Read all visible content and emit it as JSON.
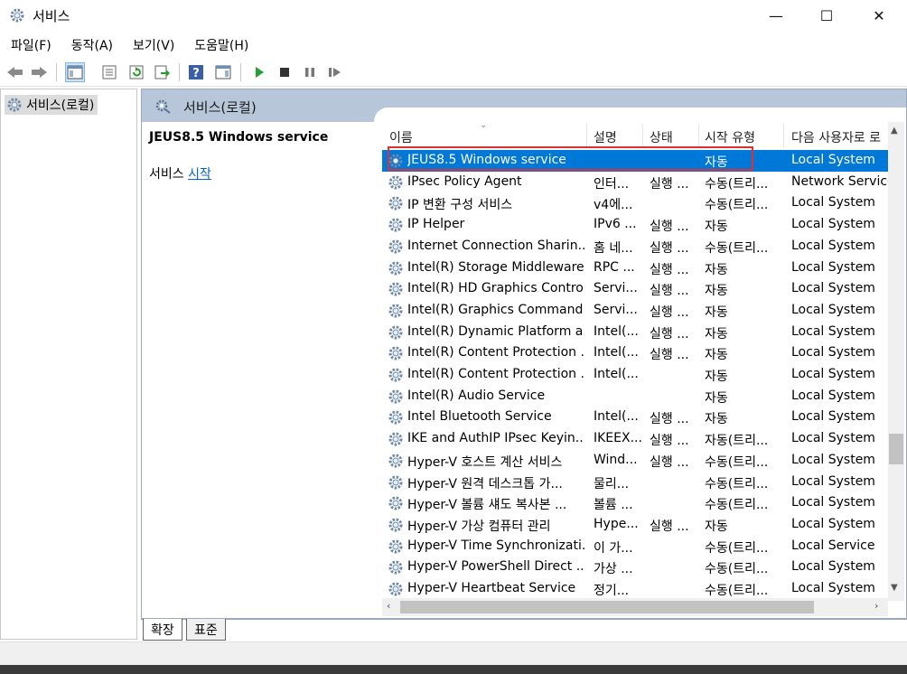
{
  "window": {
    "title": "서비스",
    "minimize_glyph": "—",
    "maximize_glyph": "☐",
    "close_glyph": "✕"
  },
  "menu": [
    "파일(F)",
    "동작(A)",
    "보기(V)",
    "도움말(H)"
  ],
  "toolbar": {
    "buttons": [
      "back-icon",
      "forward-icon",
      "show-hide-console-tree-icon",
      "properties-icon",
      "refresh-icon",
      "export-list-icon",
      "help-icon",
      "show-hide-action-pane-icon",
      "start-service-icon",
      "stop-service-icon",
      "pause-service-icon",
      "restart-service-icon"
    ]
  },
  "tree": {
    "node_label": "서비스(로컬)"
  },
  "panel": {
    "header_title": "서비스(로컬)",
    "selected_service_title": "JEUS8.5 Windows service",
    "action_prefix": "서비스 ",
    "action_link": "시작"
  },
  "columns": {
    "name": "이름",
    "description": "설명",
    "status": "상태",
    "startup": "시작 유형",
    "logon": "다음 사용자로 로"
  },
  "services": [
    {
      "name": "JEUS8.5 Windows service",
      "desc": "",
      "status": "",
      "startup": "자동",
      "logon": "Local System",
      "selected": true
    },
    {
      "name": "IPsec Policy Agent",
      "desc": "인터...",
      "status": "실행 ...",
      "startup": "수동(트리...",
      "logon": "Network Service"
    },
    {
      "name": "IP 변환 구성 서비스",
      "desc": "v4에...",
      "status": "",
      "startup": "수동(트리...",
      "logon": "Local System"
    },
    {
      "name": "IP Helper",
      "desc": "IPv6 ...",
      "status": "실행 ...",
      "startup": "자동",
      "logon": "Local System"
    },
    {
      "name": "Internet Connection Sharin...",
      "desc": "홈 네...",
      "status": "실행 ...",
      "startup": "수동(트리...",
      "logon": "Local System"
    },
    {
      "name": "Intel(R) Storage Middleware...",
      "desc": "RPC ...",
      "status": "실행 ...",
      "startup": "자동",
      "logon": "Local System"
    },
    {
      "name": "Intel(R) HD Graphics Control...",
      "desc": "Servi...",
      "status": "실행 ...",
      "startup": "자동",
      "logon": "Local System"
    },
    {
      "name": "Intel(R) Graphics Command ...",
      "desc": "Servi...",
      "status": "실행 ...",
      "startup": "자동",
      "logon": "Local System"
    },
    {
      "name": "Intel(R) Dynamic Platform a...",
      "desc": "Intel(...",
      "status": "실행 ...",
      "startup": "자동",
      "logon": "Local System"
    },
    {
      "name": "Intel(R) Content Protection ...",
      "desc": "Intel(...",
      "status": "실행 ...",
      "startup": "자동",
      "logon": "Local System"
    },
    {
      "name": "Intel(R) Content Protection ...",
      "desc": "Intel(...",
      "status": "",
      "startup": "자동",
      "logon": "Local System"
    },
    {
      "name": "Intel(R) Audio Service",
      "desc": "",
      "status": "",
      "startup": "자동",
      "logon": "Local System"
    },
    {
      "name": "Intel Bluetooth Service",
      "desc": "Intel(...",
      "status": "실행 ...",
      "startup": "자동",
      "logon": "Local System"
    },
    {
      "name": "IKE and AuthIP IPsec Keyin...",
      "desc": "IKEEX...",
      "status": "실행 ...",
      "startup": "자동(트리...",
      "logon": "Local System"
    },
    {
      "name": "Hyper-V 호스트 계산 서비스",
      "desc": "Wind...",
      "status": "실행 ...",
      "startup": "수동(트리...",
      "logon": "Local System"
    },
    {
      "name": "Hyper-V 원격 데스크톱 가...",
      "desc": "물리...",
      "status": "",
      "startup": "수동(트리...",
      "logon": "Local System"
    },
    {
      "name": "Hyper-V 볼륨 섀도 복사본 ...",
      "desc": "볼륨 ...",
      "status": "",
      "startup": "수동(트리...",
      "logon": "Local System"
    },
    {
      "name": "Hyper-V 가상 컴퓨터 관리",
      "desc": "Hype...",
      "status": "실행 ...",
      "startup": "자동",
      "logon": "Local System"
    },
    {
      "name": "Hyper-V Time Synchronizati...",
      "desc": "이 가...",
      "status": "",
      "startup": "수동(트리...",
      "logon": "Local Service"
    },
    {
      "name": "Hyper-V PowerShell Direct ...",
      "desc": "가상 ...",
      "status": "",
      "startup": "수동(트리...",
      "logon": "Local System"
    },
    {
      "name": "Hyper-V Heartbeat Service",
      "desc": "정기...",
      "status": "",
      "startup": "수동(트리...",
      "logon": "Local System"
    }
  ],
  "tabs": [
    "확장",
    "표준"
  ],
  "colors": {
    "selection": "#0078d7",
    "header_band": "#b7c6d9",
    "highlight_box": "#e03030",
    "link": "#0066cc"
  }
}
